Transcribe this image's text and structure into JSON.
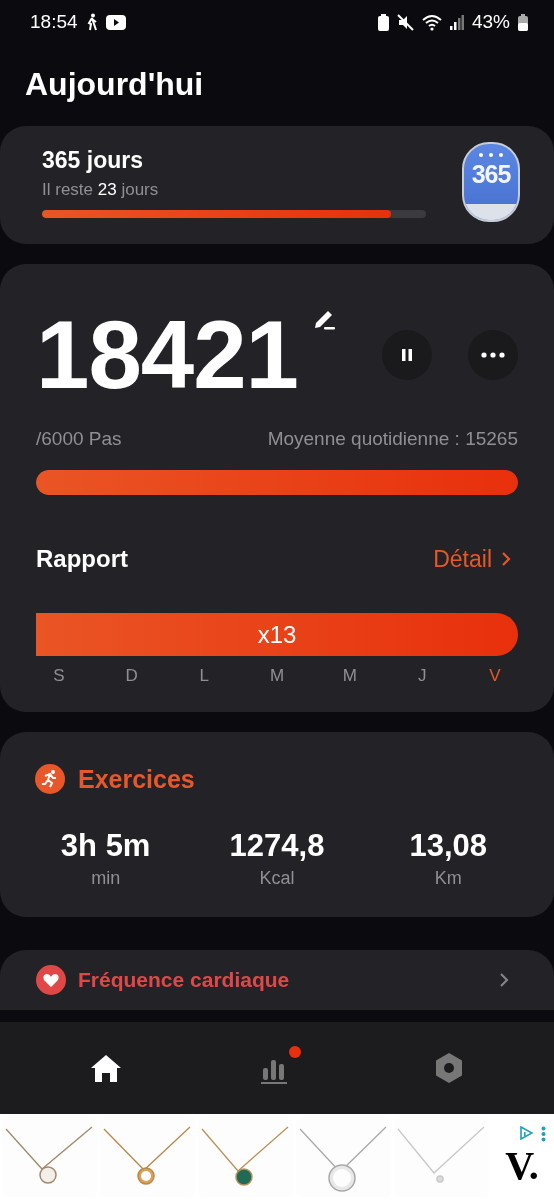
{
  "status_bar": {
    "time": "18:54",
    "battery": "43%"
  },
  "header": {
    "title": "Aujourd'hui"
  },
  "challenge": {
    "title": "365 jours",
    "subtitle_prefix": "Il reste ",
    "subtitle_count": "23",
    "subtitle_suffix": " jours",
    "level": 0.91,
    "badge": "365"
  },
  "steps": {
    "count": "18421",
    "goal": "/6000 Pas",
    "average": "Moyenne quotidienne : 15265",
    "level": 1,
    "paused": false
  },
  "report": {
    "title": "Rapport",
    "link": "Détail",
    "streak": "x13",
    "days": [
      {
        "label": "S",
        "selected": false
      },
      {
        "label": "D",
        "selected": false
      },
      {
        "label": "L",
        "selected": false
      },
      {
        "label": "M",
        "selected": false
      },
      {
        "label": "M",
        "selected": false
      },
      {
        "label": "J",
        "selected": false
      },
      {
        "label": "V",
        "selected": true
      }
    ]
  },
  "exercise": {
    "title": "Exercices",
    "stats": [
      {
        "value": "3h 5m",
        "unit": "min"
      },
      {
        "value": "1274,8",
        "unit": "Kcal"
      },
      {
        "value": "13,08",
        "unit": "Km"
      }
    ]
  },
  "heart": {
    "title": "Fréquence cardiaque"
  },
  "nav": [
    {
      "kind": "home",
      "selected": true,
      "dot": false
    },
    {
      "kind": "stats",
      "selected": false,
      "dot": true
    },
    {
      "kind": "settings",
      "selected": false,
      "dot": false
    }
  ],
  "ad": {
    "logo": "V."
  }
}
